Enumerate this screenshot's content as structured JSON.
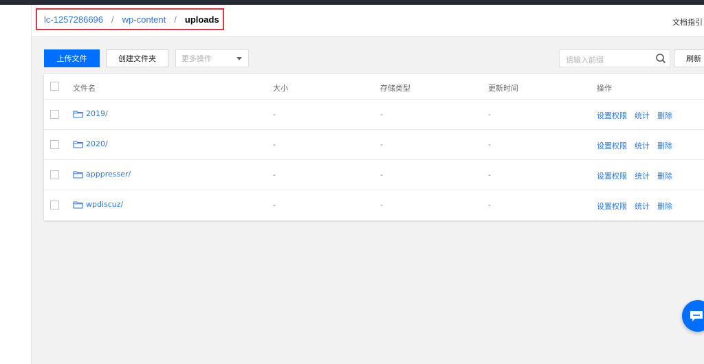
{
  "breadcrumb": {
    "items": [
      "lc-1257286696",
      "wp-content"
    ],
    "separator": "/",
    "current": "uploads"
  },
  "header": {
    "doc_guide": "文档指引"
  },
  "toolbar": {
    "upload_label": "上传文件",
    "create_folder_label": "创建文件夹",
    "more_actions_placeholder": "更多操作",
    "search_placeholder": "请输入前缀",
    "refresh_label": "刷新"
  },
  "table": {
    "columns": [
      "文件名",
      "大小",
      "存储类型",
      "更新时间",
      "操作"
    ],
    "rows": [
      {
        "name": "2019/",
        "size": "-",
        "storage": "-",
        "updated": "-",
        "actions": [
          "设置权限",
          "统计",
          "删除"
        ]
      },
      {
        "name": "2020/",
        "size": "-",
        "storage": "-",
        "updated": "-",
        "actions": [
          "设置权限",
          "统计",
          "删除"
        ]
      },
      {
        "name": "apppresser/",
        "size": "-",
        "storage": "-",
        "updated": "-",
        "actions": [
          "设置权限",
          "统计",
          "删除"
        ]
      },
      {
        "name": "wpdiscuz/",
        "size": "-",
        "storage": "-",
        "updated": "-",
        "actions": [
          "设置权限",
          "统计",
          "删除"
        ]
      }
    ]
  },
  "icons": {
    "folder": "folder-icon",
    "search": "search-icon",
    "chat": "chat-icon",
    "caret": "chevron-down-icon"
  },
  "colors": {
    "primary": "#006eff",
    "link": "#2e75d9",
    "highlight_border": "#e0353f",
    "topbar": "#262b36"
  }
}
